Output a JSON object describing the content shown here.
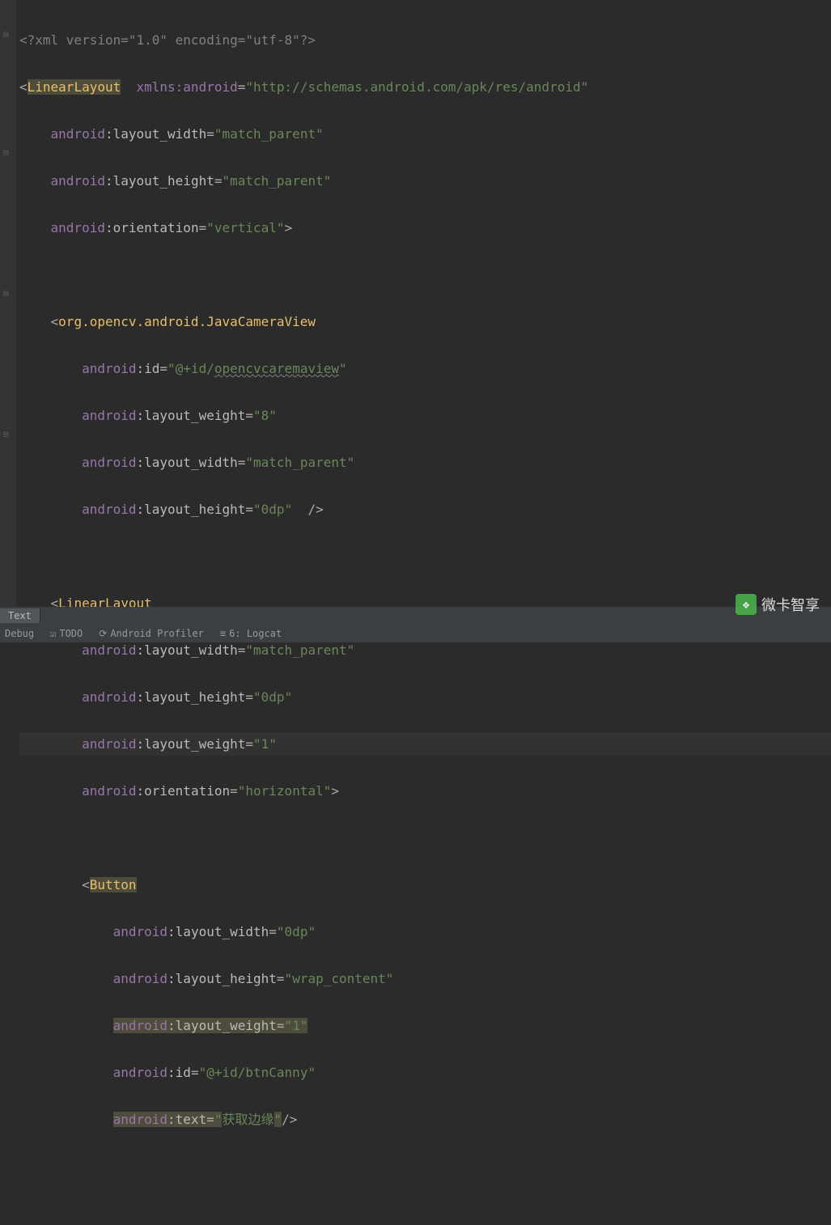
{
  "code": {
    "prolog": "<?xml version=\"1.0\" encoding=\"utf-8\"?>",
    "root_tag": "LinearLayout",
    "ns_attr": "xmlns:android",
    "ns_url": "http://schemas.android.com/apk/res/android",
    "ns": "android",
    "attrs": {
      "layout_width": "layout_width",
      "layout_height": "layout_height",
      "orientation": "orientation",
      "id": "id",
      "layout_weight": "layout_weight",
      "text": "text"
    },
    "vals": {
      "match_parent": "match_parent",
      "vertical": "vertical",
      "horizontal": "horizontal",
      "zero_dp": "0dp",
      "wrap_content": "wrap_content",
      "eight": "8",
      "one": "1",
      "id_camera": "@+id/opencvcaremaview",
      "id_camera_pref": "@+id/",
      "id_camera_suf": "opencvcaremaview",
      "id_btn": "@+id/btnCanny",
      "btn_text": "获取边缘"
    },
    "tags": {
      "camera_view": "org.opencv.android.JavaCameraView",
      "linear_layout": "LinearLayout",
      "button": "Button"
    }
  },
  "tabs": {
    "text": "Text"
  },
  "toolbar": {
    "debug": "Debug",
    "todo": "TODO",
    "profiler": "Android Profiler",
    "logcat": "6: Logcat"
  },
  "watermark": {
    "text": "微卡智享"
  }
}
